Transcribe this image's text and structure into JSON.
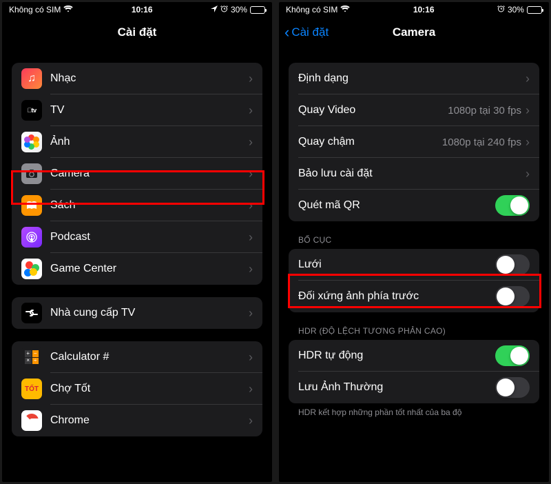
{
  "status": {
    "carrier": "Không có SIM",
    "time": "10:16",
    "battery_pct": "30%"
  },
  "left": {
    "title": "Cài đặt",
    "group1": [
      {
        "key": "music",
        "label": "Nhạc"
      },
      {
        "key": "tv",
        "label": "TV"
      },
      {
        "key": "photos",
        "label": "Ảnh"
      },
      {
        "key": "camera",
        "label": "Camera"
      },
      {
        "key": "books",
        "label": "Sách"
      },
      {
        "key": "podcast",
        "label": "Podcast"
      },
      {
        "key": "gamecenter",
        "label": "Game Center"
      }
    ],
    "group2": [
      {
        "key": "tvprovider",
        "label": "Nhà cung cấp TV"
      }
    ],
    "group3": [
      {
        "key": "calc",
        "label": "Calculator #"
      },
      {
        "key": "chotot",
        "label": "Chợ Tốt"
      },
      {
        "key": "chrome",
        "label": "Chrome"
      }
    ]
  },
  "right": {
    "back": "Cài đặt",
    "title": "Camera",
    "group1": [
      {
        "label": "Định dạng",
        "value": ""
      },
      {
        "label": "Quay Video",
        "value": "1080p tại 30 fps"
      },
      {
        "label": "Quay chậm",
        "value": "1080p tại 240 fps"
      },
      {
        "label": "Bảo lưu cài đặt",
        "value": ""
      },
      {
        "label": "Quét mã QR",
        "toggle": "on"
      }
    ],
    "section2_header": "BỐ CỤC",
    "group2": [
      {
        "label": "Lưới",
        "toggle": "off"
      },
      {
        "label": "Đối xứng ảnh phía trước",
        "toggle": "off"
      }
    ],
    "section3_header": "HDR (ĐỘ LỆCH TƯƠNG PHẢN CAO)",
    "group3": [
      {
        "label": "HDR tự động",
        "toggle": "on"
      },
      {
        "label": "Lưu Ảnh Thường",
        "toggle": "off"
      }
    ],
    "footer3": "HDR kết hợp những phần tốt nhất của ba độ"
  }
}
